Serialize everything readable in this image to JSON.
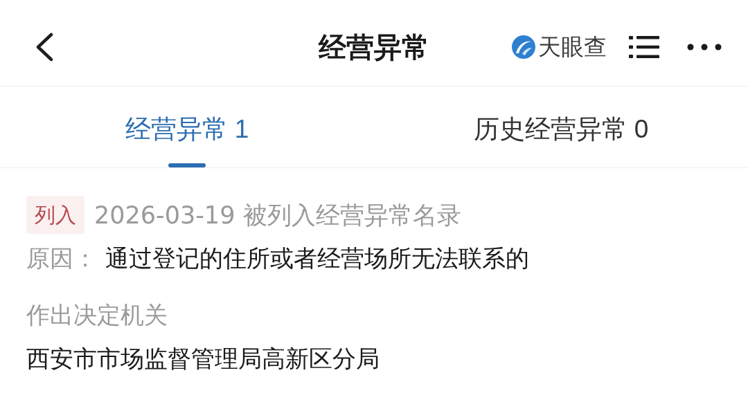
{
  "header": {
    "title": "经营异常",
    "brand": "天眼查"
  },
  "tabs": [
    {
      "label": "经营异常 1",
      "selected": true
    },
    {
      "label": "历史经营异常 0",
      "selected": false
    }
  ],
  "record": {
    "tag": "列入",
    "date_text": "2026-03-19 被列入经营异常名录",
    "reason_label": "原因：",
    "reason": "通过登记的住所或者经营场所无法联系的",
    "authority_label": "作出决定机关",
    "authority": "西安市市场监督管理局高新区分局"
  }
}
